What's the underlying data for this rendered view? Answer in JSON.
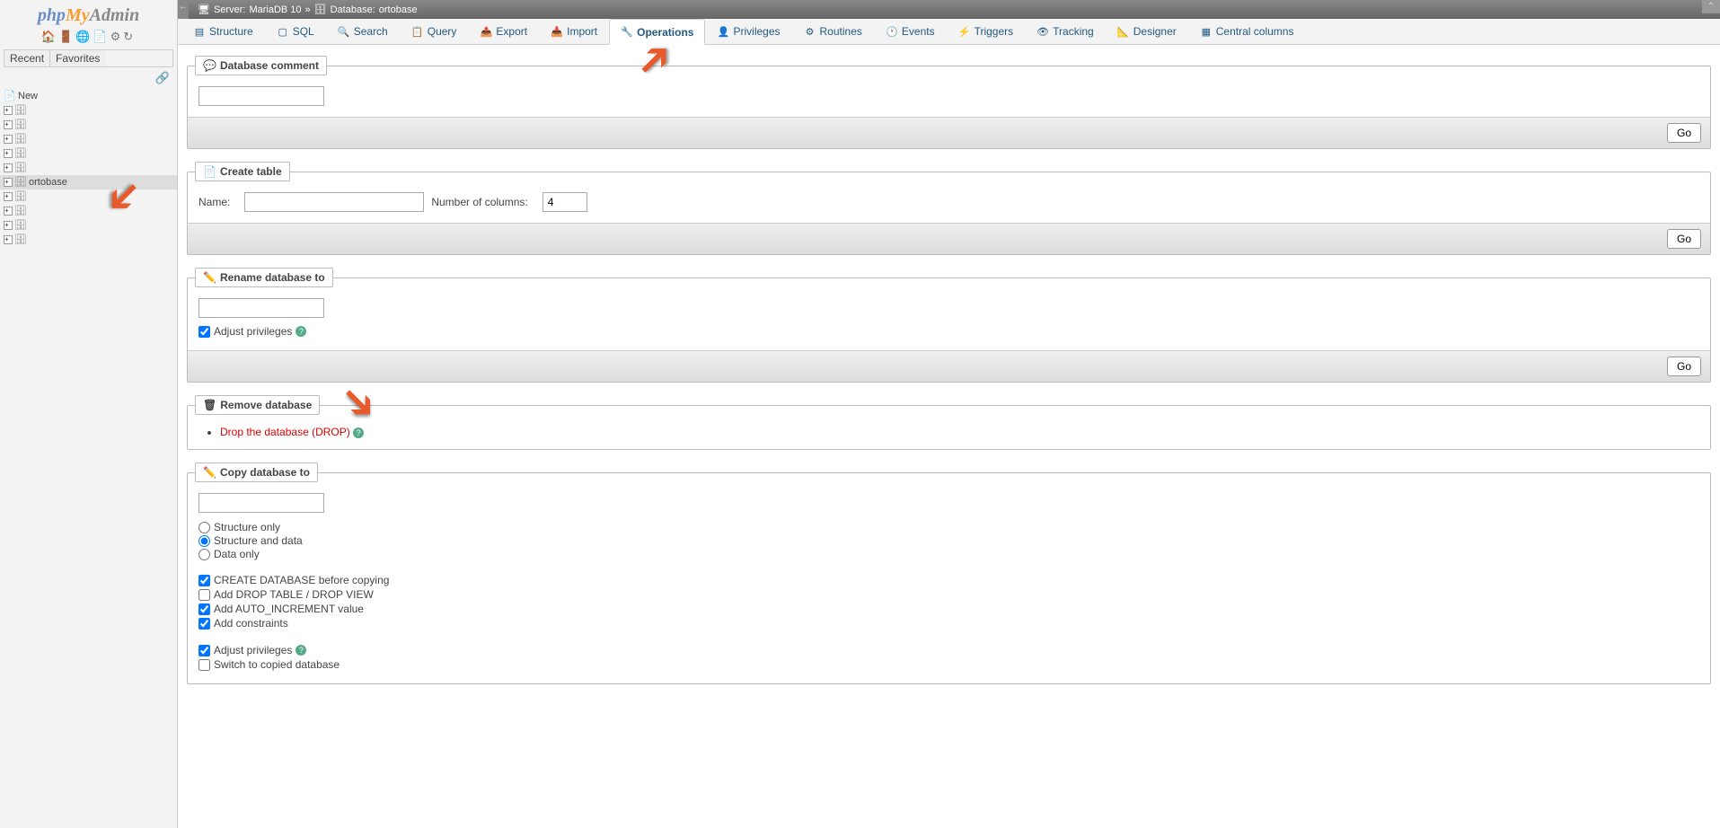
{
  "logo": {
    "php": "php",
    "my": "My",
    "admin": "Admin"
  },
  "sidebar": {
    "recent": "Recent",
    "favorites": "Favorites",
    "new": "New",
    "db": "ortobase"
  },
  "breadcrumb": {
    "server_label": "Server:",
    "server": "MariaDB 10",
    "sep": "»",
    "db_label": "Database:",
    "db": "ortobase"
  },
  "tabs": {
    "structure": "Structure",
    "sql": "SQL",
    "search": "Search",
    "query": "Query",
    "export": "Export",
    "import": "Import",
    "operations": "Operations",
    "privileges": "Privileges",
    "routines": "Routines",
    "events": "Events",
    "triggers": "Triggers",
    "tracking": "Tracking",
    "designer": "Designer",
    "central": "Central columns"
  },
  "comment": {
    "legend": "Database comment"
  },
  "create": {
    "legend": "Create table",
    "name_label": "Name:",
    "cols_label": "Number of columns:",
    "cols_value": "4"
  },
  "rename": {
    "legend": "Rename database to",
    "adjust": "Adjust privileges"
  },
  "remove": {
    "legend": "Remove database",
    "drop": "Drop the database (DROP)"
  },
  "copy": {
    "legend": "Copy database to",
    "structure_only": "Structure only",
    "structure_data": "Structure and data",
    "data_only": "Data only",
    "create_before": "CREATE DATABASE before copying",
    "add_drop": "Add DROP TABLE / DROP VIEW",
    "add_ai": "Add AUTO_INCREMENT value",
    "add_constraints": "Add constraints",
    "adjust": "Adjust privileges",
    "switch": "Switch to copied database"
  },
  "go": "Go"
}
